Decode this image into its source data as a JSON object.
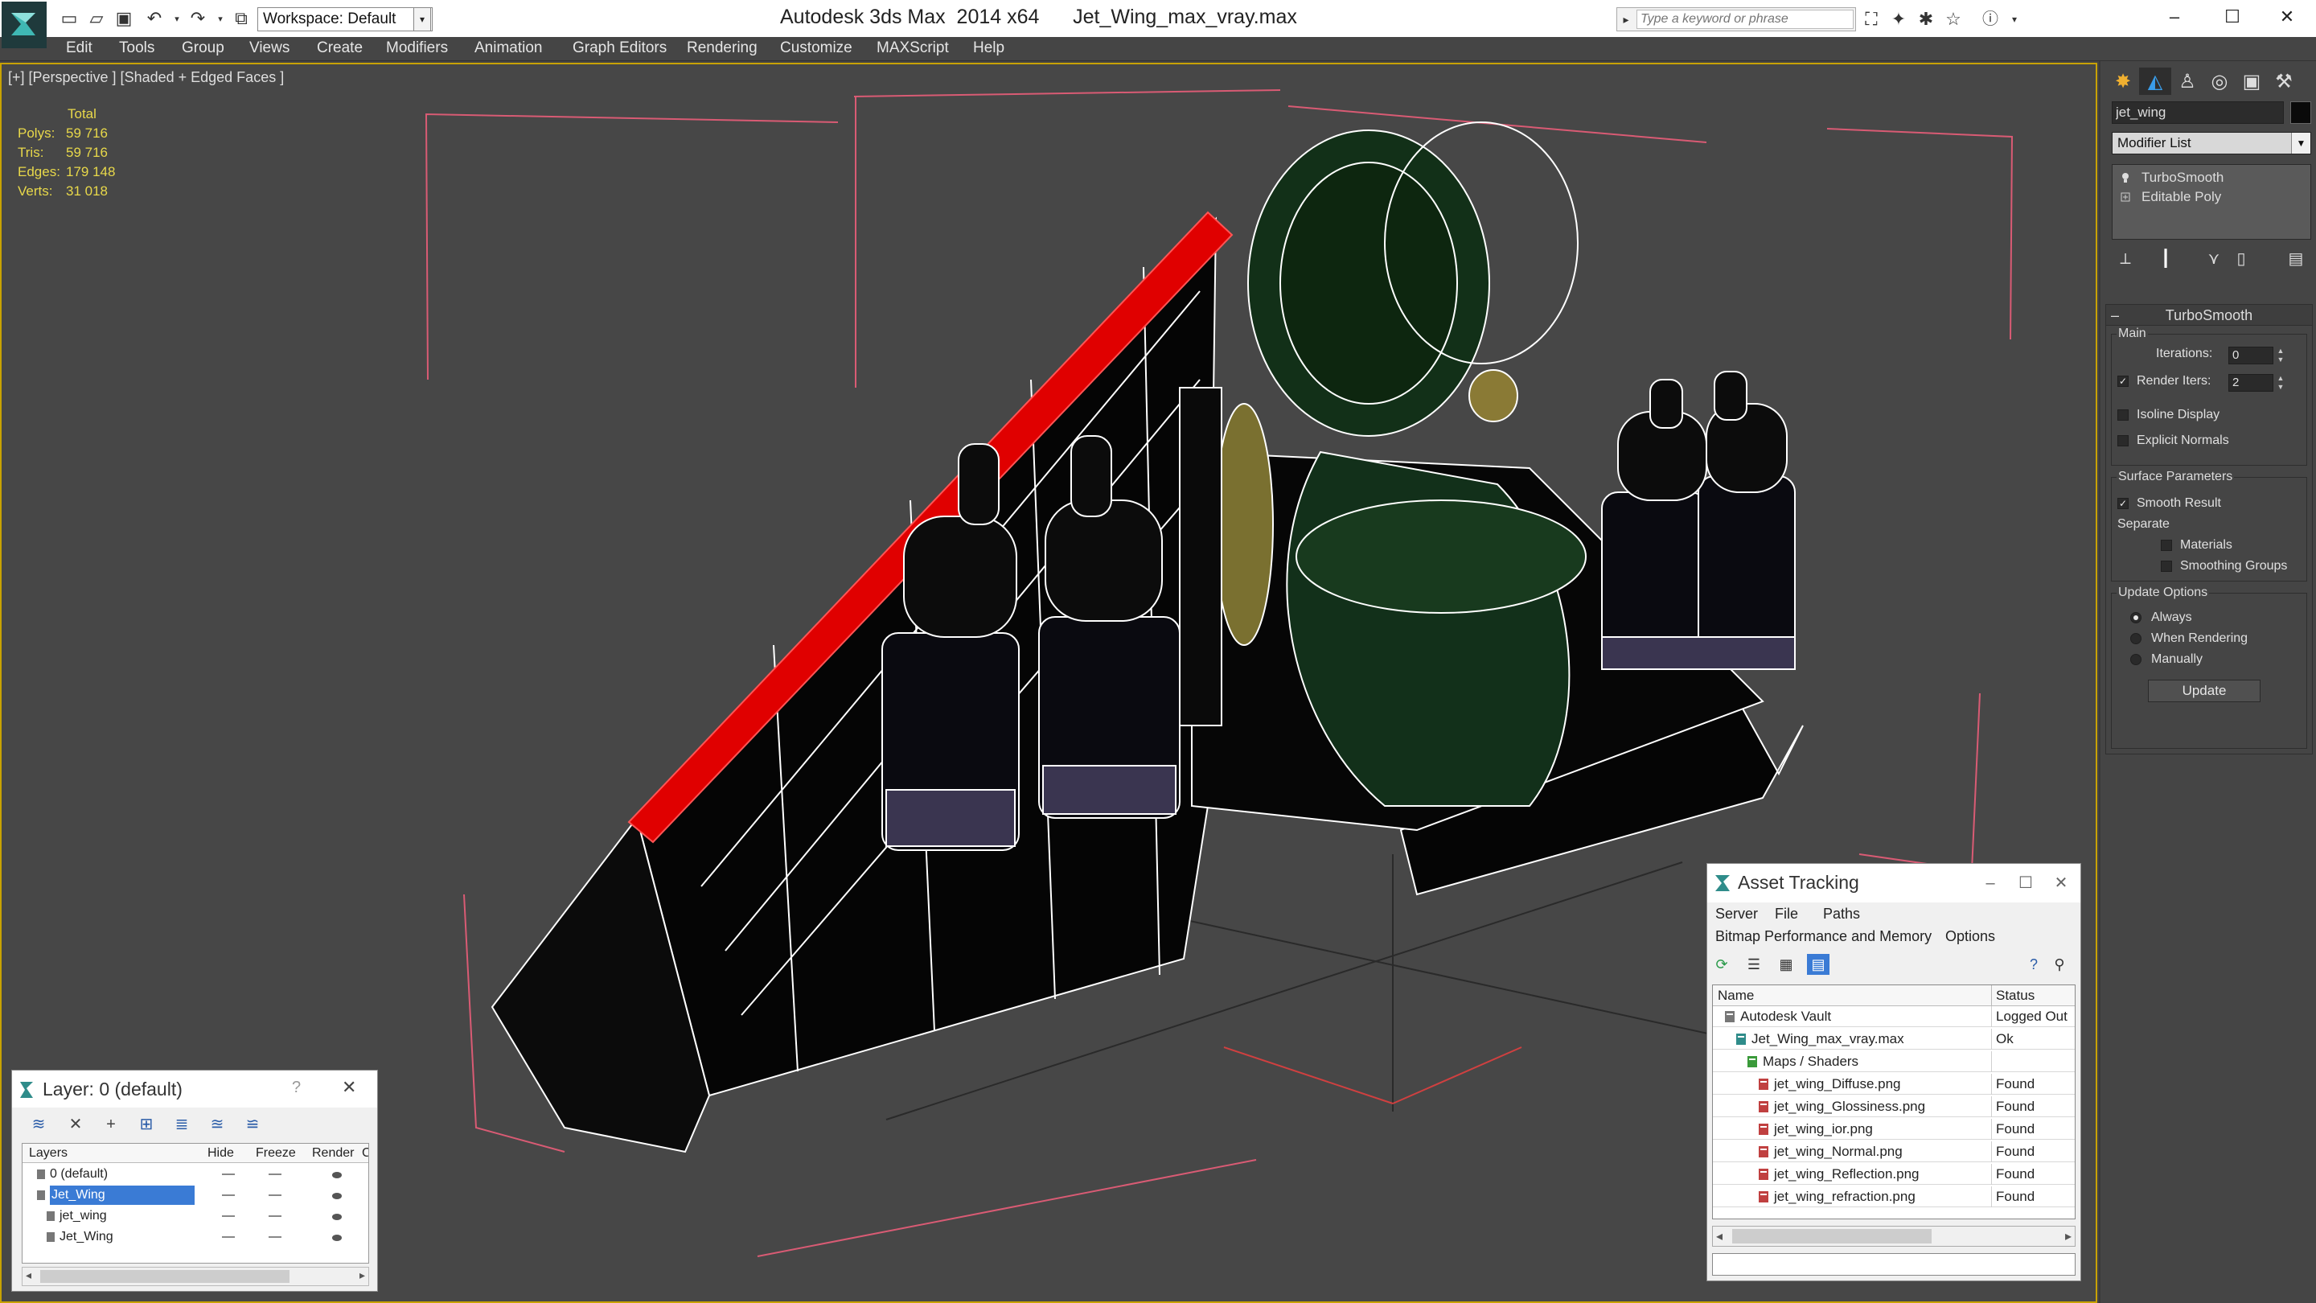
{
  "titlebar": {
    "workspace": "Workspace: Default",
    "app_title": "Autodesk 3ds Max  2014 x64      Jet_Wing_max_vray.max",
    "search_placeholder": "Type a keyword or phrase",
    "minimize": "–",
    "maximize": "☐",
    "close": "✕"
  },
  "menu": [
    "Edit",
    "Tools",
    "Group",
    "Views",
    "Create",
    "Modifiers",
    "Animation",
    "Graph Editors",
    "Rendering",
    "Customize",
    "MAXScript",
    "Help"
  ],
  "viewport": {
    "label": "[+] [Perspective ] [Shaded + Edged Faces ]",
    "stats": {
      "header": "Total",
      "rows": [
        {
          "label": "Polys:",
          "value": "59 716"
        },
        {
          "label": "Tris:",
          "value": "59 716"
        },
        {
          "label": "Edges:",
          "value": "179 148"
        },
        {
          "label": "Verts:",
          "value": "31 018"
        }
      ]
    }
  },
  "command_panel": {
    "object_name": "jet_wing",
    "modifier_list": "Modifier List",
    "stack": [
      "TurboSmooth",
      "Editable Poly"
    ],
    "turbosmooth": {
      "title": "TurboSmooth",
      "main_label": "Main",
      "iterations_label": "Iterations:",
      "iterations_value": "0",
      "render_iters_label": "Render Iters:",
      "render_iters_value": "2",
      "render_iters_checked": true,
      "isoline_label": "Isoline Display",
      "explicit_label": "Explicit Normals",
      "surface_label": "Surface Parameters",
      "smooth_result_label": "Smooth Result",
      "separate_label": "Separate",
      "materials_label": "Materials",
      "smoothing_groups_label": "Smoothing Groups",
      "update_options_label": "Update Options",
      "always_label": "Always",
      "when_rendering_label": "When Rendering",
      "manually_label": "Manually",
      "update_button": "Update"
    }
  },
  "asset_tracking": {
    "title": "Asset Tracking",
    "menu1": [
      "Server",
      "File",
      "Paths"
    ],
    "menu2": [
      "Bitmap Performance and Memory",
      "Options"
    ],
    "col_name": "Name",
    "col_status": "Status",
    "rows": [
      {
        "name": "Autodesk Vault",
        "status": "Logged Out",
        "indent": 0,
        "icon": "vault-icon"
      },
      {
        "name": "Jet_Wing_max_vray.max",
        "status": "Ok",
        "indent": 1,
        "icon": "max-file-icon"
      },
      {
        "name": "Maps / Shaders",
        "status": "",
        "indent": 2,
        "icon": "maps-folder-icon"
      },
      {
        "name": "jet_wing_Diffuse.png",
        "status": "Found",
        "indent": 3,
        "icon": "bitmap-icon"
      },
      {
        "name": "jet_wing_Glossiness.png",
        "status": "Found",
        "indent": 3,
        "icon": "bitmap-icon"
      },
      {
        "name": "jet_wing_ior.png",
        "status": "Found",
        "indent": 3,
        "icon": "bitmap-icon"
      },
      {
        "name": "jet_wing_Normal.png",
        "status": "Found",
        "indent": 3,
        "icon": "bitmap-icon"
      },
      {
        "name": "jet_wing_Reflection.png",
        "status": "Found",
        "indent": 3,
        "icon": "bitmap-icon"
      },
      {
        "name": "jet_wing_refraction.png",
        "status": "Found",
        "indent": 3,
        "icon": "bitmap-icon"
      }
    ]
  },
  "layer_explorer": {
    "title": "Layer: 0 (default)",
    "help": "?",
    "close": "✕",
    "columns": [
      "Layers",
      "Hide",
      "Freeze",
      "Render",
      "C"
    ],
    "rows": [
      {
        "name": "0 (default)",
        "indent": 1,
        "selected": false
      },
      {
        "name": "Jet_Wing",
        "indent": 1,
        "selected": true
      },
      {
        "name": "jet_wing",
        "indent": 2,
        "selected": false
      },
      {
        "name": "Jet_Wing",
        "indent": 2,
        "selected": false
      }
    ]
  },
  "colors": {
    "viewport_bg": "#474747",
    "viewport_border": "#c8a200",
    "stats_text": "#e8d84a",
    "selection_blue": "#3a7bd5",
    "red_edge": "#e00000"
  }
}
